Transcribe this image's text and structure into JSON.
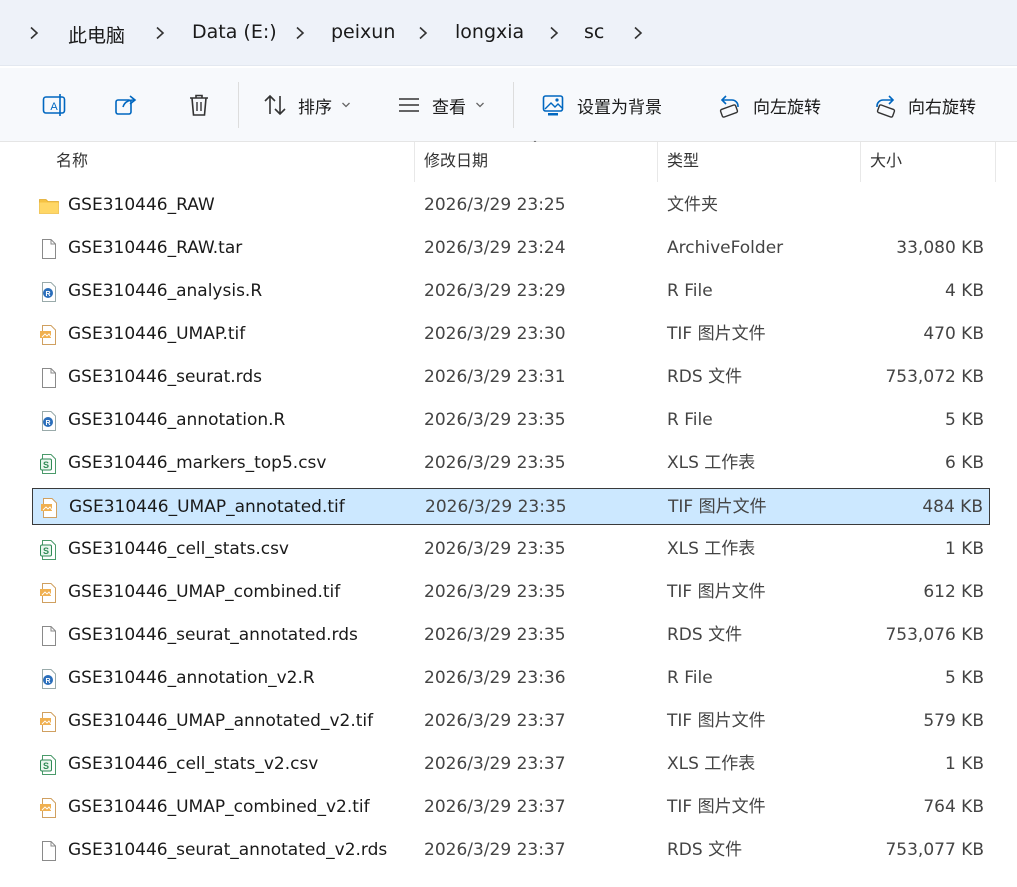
{
  "breadcrumb": [
    "此电脑",
    "Data (E:)",
    "peixun",
    "longxia",
    "sc"
  ],
  "toolbar": {
    "sort_label": "排序",
    "view_label": "查看",
    "set_background_label": "设置为背景",
    "rotate_left_label": "向左旋转",
    "rotate_right_label": "向右旋转"
  },
  "columns": {
    "name": "名称",
    "date": "修改日期",
    "type": "类型",
    "size": "大小"
  },
  "selected_index": 7,
  "colors": {
    "selection_bg": "#cce8ff",
    "folder": "#f5c242",
    "accent": "#0067c0"
  },
  "files": [
    {
      "name": "GSE310446_RAW",
      "date": "2026/3/29 23:25",
      "type": "文件夹",
      "size": "",
      "icon": "folder-icon"
    },
    {
      "name": "GSE310446_RAW.tar",
      "date": "2026/3/29 23:24",
      "type": "ArchiveFolder",
      "size": "33,080 KB",
      "icon": "file-icon"
    },
    {
      "name": "GSE310446_analysis.R",
      "date": "2026/3/29 23:29",
      "type": "R File",
      "size": "4 KB",
      "icon": "r-file-icon"
    },
    {
      "name": "GSE310446_UMAP.tif",
      "date": "2026/3/29 23:30",
      "type": "TIF 图片文件",
      "size": "470 KB",
      "icon": "image-file-icon"
    },
    {
      "name": "GSE310446_seurat.rds",
      "date": "2026/3/29 23:31",
      "type": "RDS 文件",
      "size": "753,072 KB",
      "icon": "file-icon"
    },
    {
      "name": "GSE310446_annotation.R",
      "date": "2026/3/29 23:35",
      "type": "R File",
      "size": "5 KB",
      "icon": "r-file-icon"
    },
    {
      "name": "GSE310446_markers_top5.csv",
      "date": "2026/3/29 23:35",
      "type": "XLS 工作表",
      "size": "6 KB",
      "icon": "spreadsheet-icon"
    },
    {
      "name": "GSE310446_UMAP_annotated.tif",
      "date": "2026/3/29 23:35",
      "type": "TIF 图片文件",
      "size": "484 KB",
      "icon": "image-file-icon"
    },
    {
      "name": "GSE310446_cell_stats.csv",
      "date": "2026/3/29 23:35",
      "type": "XLS 工作表",
      "size": "1 KB",
      "icon": "spreadsheet-icon"
    },
    {
      "name": "GSE310446_UMAP_combined.tif",
      "date": "2026/3/29 23:35",
      "type": "TIF 图片文件",
      "size": "612 KB",
      "icon": "image-file-icon"
    },
    {
      "name": "GSE310446_seurat_annotated.rds",
      "date": "2026/3/29 23:35",
      "type": "RDS 文件",
      "size": "753,076 KB",
      "icon": "file-icon"
    },
    {
      "name": "GSE310446_annotation_v2.R",
      "date": "2026/3/29 23:36",
      "type": "R File",
      "size": "5 KB",
      "icon": "r-file-icon"
    },
    {
      "name": "GSE310446_UMAP_annotated_v2.tif",
      "date": "2026/3/29 23:37",
      "type": "TIF 图片文件",
      "size": "579 KB",
      "icon": "image-file-icon"
    },
    {
      "name": "GSE310446_cell_stats_v2.csv",
      "date": "2026/3/29 23:37",
      "type": "XLS 工作表",
      "size": "1 KB",
      "icon": "spreadsheet-icon"
    },
    {
      "name": "GSE310446_UMAP_combined_v2.tif",
      "date": "2026/3/29 23:37",
      "type": "TIF 图片文件",
      "size": "764 KB",
      "icon": "image-file-icon"
    },
    {
      "name": "GSE310446_seurat_annotated_v2.rds",
      "date": "2026/3/29 23:37",
      "type": "RDS 文件",
      "size": "753,077 KB",
      "icon": "file-icon"
    }
  ]
}
